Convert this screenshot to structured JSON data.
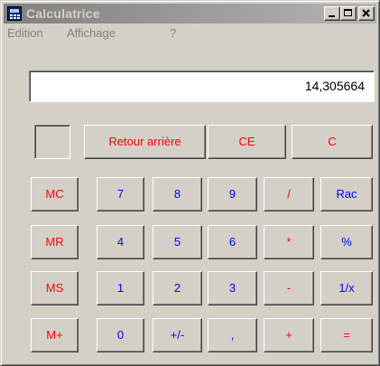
{
  "window": {
    "title": "Calculatrice"
  },
  "menu": {
    "items": [
      "Edition",
      "Affichage",
      "?"
    ]
  },
  "display": {
    "value": "14,305664"
  },
  "colors": {
    "operator_text": "#ff0000",
    "digit_text": "#0000ff",
    "face": "#d4d0c8"
  },
  "keys": {
    "backspace": "Retour arrière",
    "ce": "CE",
    "c": "C",
    "mc": "MC",
    "mr": "MR",
    "ms": "MS",
    "mplus": "M+",
    "d7": "7",
    "d8": "8",
    "d9": "9",
    "d4": "4",
    "d5": "5",
    "d6": "6",
    "d1": "1",
    "d2": "2",
    "d3": "3",
    "d0": "0",
    "sign": "+/-",
    "decimal": ",",
    "div": "/",
    "mul": "*",
    "sub": "-",
    "add": "+",
    "sqrt": "Rac",
    "pct": "%",
    "inv": "1/x",
    "eq": "="
  }
}
